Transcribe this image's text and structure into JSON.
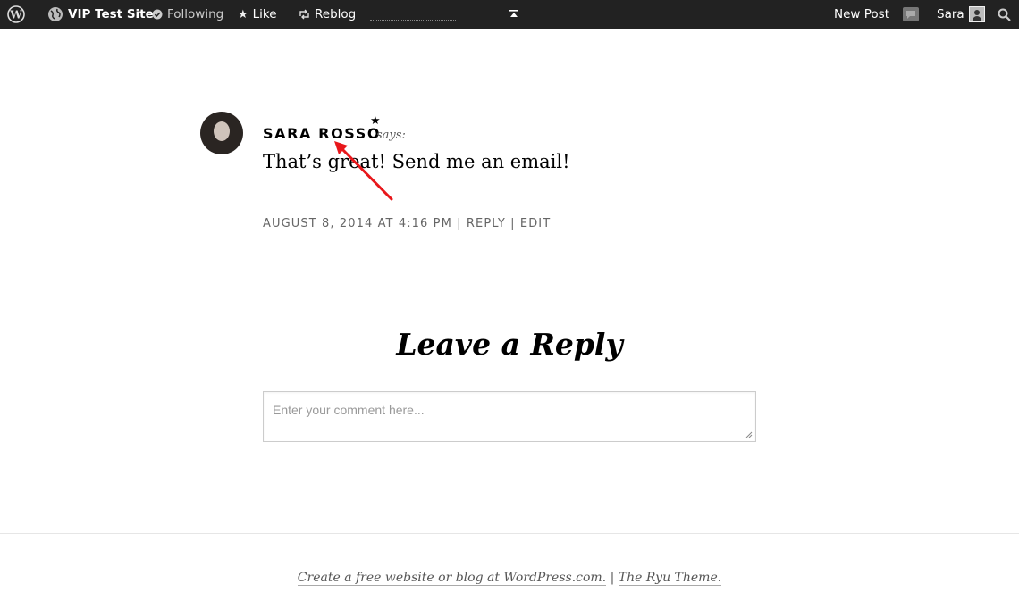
{
  "adminbar": {
    "site_name": "VIP Test Site",
    "following_label": "Following",
    "like_label": "Like",
    "reblog_label": "Reblog",
    "new_post_label": "New Post",
    "user_name": "Sara"
  },
  "comment": {
    "author": "SARA ROSSO",
    "star": "★",
    "says": "says:",
    "text": "That’s great! Send me an email!",
    "date": "AUGUST 8, 2014 AT 4:16 PM",
    "separator": "|",
    "reply_label": "REPLY",
    "edit_label": "EDIT",
    "annotation_color": "#e8171b"
  },
  "reply_form": {
    "title": "Leave a Reply",
    "placeholder": "Enter your comment here..."
  },
  "footer": {
    "link1": "Create a free website or blog at WordPress.com.",
    "separator": "|",
    "link2": "The Ryu Theme."
  }
}
